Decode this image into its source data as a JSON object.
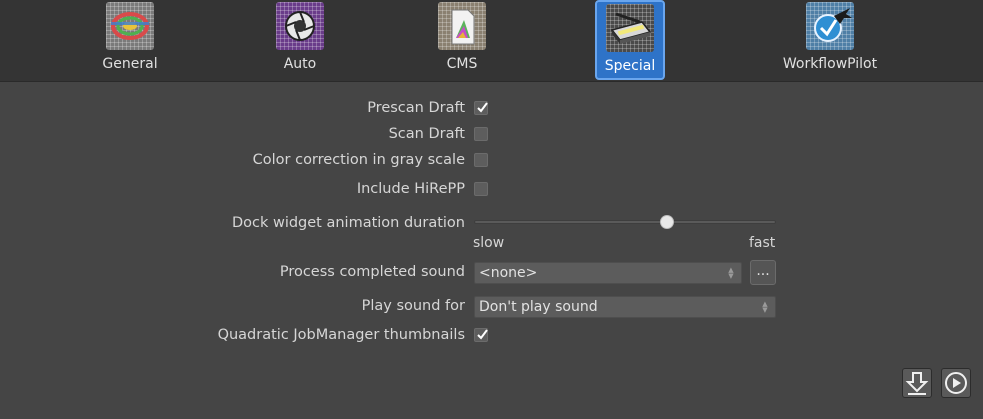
{
  "toolbar": {
    "items": [
      {
        "label": "General",
        "icon": "color-wheel-icon"
      },
      {
        "label": "Auto",
        "icon": "aperture-icon"
      },
      {
        "label": "CMS",
        "icon": "color-profile-icon"
      },
      {
        "label": "Special",
        "icon": "scanner-icon",
        "active": true
      },
      {
        "label": "WorkflowPilot",
        "icon": "airplane-icon"
      }
    ]
  },
  "settings": {
    "prescan_draft": {
      "label": "Prescan Draft",
      "checked": true
    },
    "scan_draft": {
      "label": "Scan Draft",
      "checked": false
    },
    "color_correction_gray": {
      "label": "Color correction in gray scale",
      "checked": false
    },
    "include_hirepp": {
      "label": "Include HiRePP",
      "checked": false
    },
    "dock_animation": {
      "label": "Dock widget animation duration",
      "min_label": "slow",
      "max_label": "fast",
      "value": 0.64
    },
    "process_sound": {
      "label": "Process completed sound",
      "value": "<none>",
      "browse_label": "..."
    },
    "play_sound_for": {
      "label": "Play sound for",
      "value": "Don't play sound"
    },
    "quadratic_thumbnails": {
      "label": "Quadratic JobManager thumbnails",
      "checked": true
    }
  },
  "colors": {
    "background": "#454545",
    "toolbar": "#343434",
    "active_accent": "#2e73c8"
  }
}
